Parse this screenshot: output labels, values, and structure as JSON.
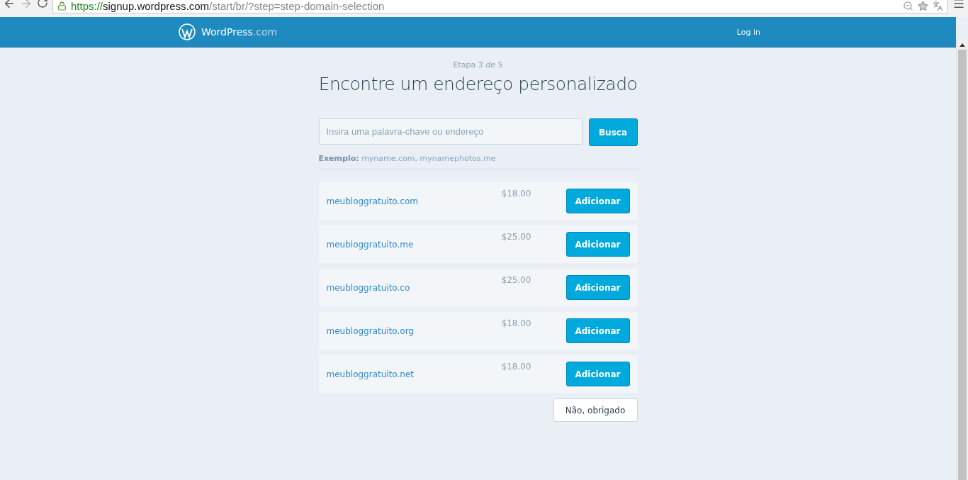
{
  "browser": {
    "url_scheme": "https://",
    "url_host": "signup.wordpress.com",
    "url_path": "/start/br/?step=step-domain-selection"
  },
  "header": {
    "logo_main": "WordPress",
    "logo_suffix": ".com",
    "login": "Log in"
  },
  "step": "Etapa 3 *de* 5",
  "title": "Encontre um endereço personalizado",
  "search": {
    "placeholder": "Insira uma palavra-chave ou endereço",
    "button": "Busca"
  },
  "example": {
    "label": "Exemplo:",
    "text": "myname.com, mynamephotos.me"
  },
  "domains": [
    {
      "name": "meubloggratuito.com",
      "price": "$18.00",
      "button": "Adicionar"
    },
    {
      "name": "meubloggratuito.me",
      "price": "$25.00",
      "button": "Adicionar"
    },
    {
      "name": "meubloggratuito.co",
      "price": "$25.00",
      "button": "Adicionar"
    },
    {
      "name": "meubloggratuito.org",
      "price": "$18.00",
      "button": "Adicionar"
    },
    {
      "name": "meubloggratuito.net",
      "price": "$18.00",
      "button": "Adicionar"
    }
  ],
  "skip_button": "Não, obrigado"
}
